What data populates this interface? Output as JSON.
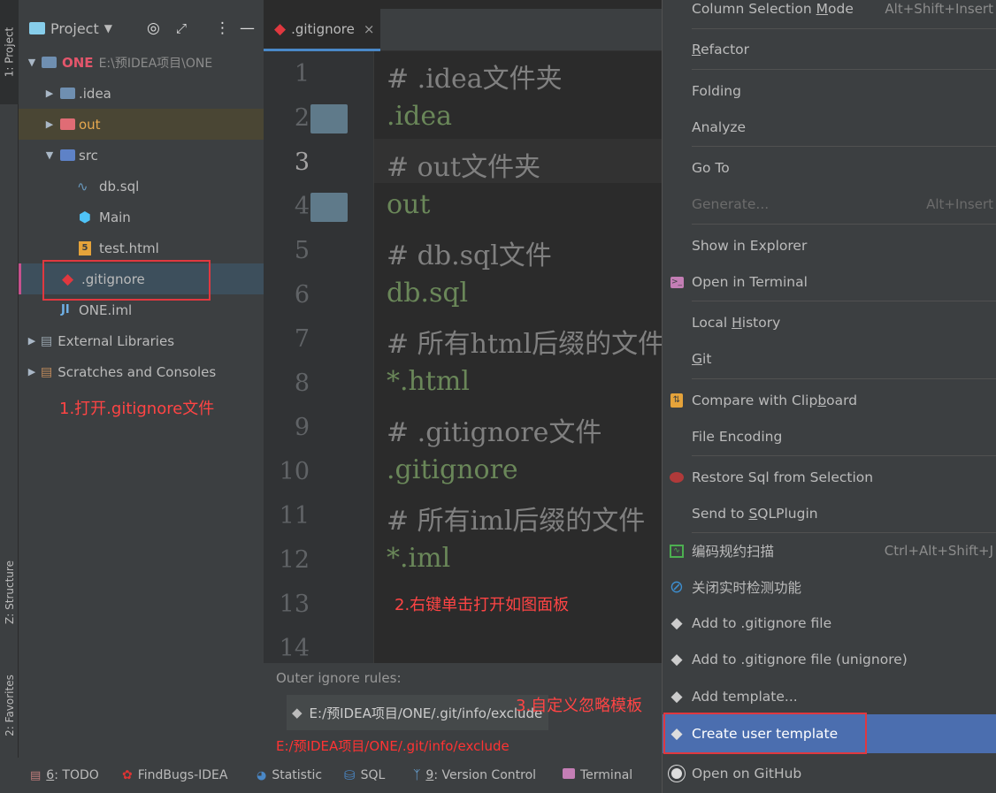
{
  "left_strip": {
    "project_tab": "1: Project",
    "structure_tab": "Z: Structure",
    "favorites_tab": "2: Favorites"
  },
  "project_panel": {
    "view_label": "Project",
    "root": {
      "name": "ONE",
      "path": "E:\\预IDEA项目\\ONE"
    },
    "items": [
      {
        "label": ".idea",
        "icon": "folder-idea-icon"
      },
      {
        "label": "out",
        "icon": "folder-out-icon"
      },
      {
        "label": "src",
        "icon": "folder-src-icon"
      },
      {
        "label": "db.sql",
        "icon": "sql-file-icon"
      },
      {
        "label": "Main",
        "icon": "java-class-icon"
      },
      {
        "label": "test.html",
        "icon": "html-file-icon"
      },
      {
        "label": ".gitignore",
        "icon": "gitignore-file-icon"
      },
      {
        "label": "ONE.iml",
        "icon": "iml-file-icon"
      },
      {
        "label": "External Libraries",
        "icon": "library-icon"
      },
      {
        "label": "Scratches and Consoles",
        "icon": "scratches-icon"
      }
    ],
    "annotation": "1.打开.gitignore文件"
  },
  "editor": {
    "tab_label": ".gitignore",
    "tab_close": "×",
    "lines": [
      {
        "n": "1",
        "text": "# .idea文件夹",
        "kind": "comment"
      },
      {
        "n": "2",
        "text": ".idea",
        "kind": "entry"
      },
      {
        "n": "3",
        "text": "# out文件夹",
        "kind": "comment"
      },
      {
        "n": "4",
        "text": "out",
        "kind": "entry"
      },
      {
        "n": "5",
        "text": "# db.sql文件",
        "kind": "comment"
      },
      {
        "n": "6",
        "text": "db.sql",
        "kind": "entry"
      },
      {
        "n": "7",
        "text": "# 所有html后缀的文件",
        "kind": "comment"
      },
      {
        "n": "8",
        "text": "*.html",
        "kind": "entry"
      },
      {
        "n": "9",
        "text": "# .gitignore文件",
        "kind": "comment"
      },
      {
        "n": "10",
        "text": ".gitignore",
        "kind": "entry"
      },
      {
        "n": "11",
        "text": "# 所有iml后缀的文件",
        "kind": "comment"
      },
      {
        "n": "12",
        "text": "*.iml",
        "kind": "entry"
      },
      {
        "n": "13",
        "text": "",
        "kind": "comment"
      },
      {
        "n": "14",
        "text": "",
        "kind": "comment"
      }
    ],
    "annotation_2": "2.右键单击打开如图面板",
    "outer_rules_label": "Outer ignore rules:",
    "outer_rules_item": "E:/预IDEA项目/ONE/.git/info/exclude",
    "outer_rules_link": "E:/预IDEA项目/ONE/.git/info/exclude",
    "annotation_3": "3.自定义忽略模板"
  },
  "context_menu": {
    "column_selection": {
      "pre": "Column Selection ",
      "u": "M",
      "post": "ode",
      "shortcut": "Alt+Shift+Insert"
    },
    "refactor": {
      "pre": "",
      "u": "R",
      "post": "efactor"
    },
    "folding": "Folding",
    "analyze": "Analyze",
    "goto": "Go To",
    "generate": {
      "label": "Generate...",
      "shortcut": "Alt+Insert"
    },
    "show_in_explorer": "Show in Explorer",
    "open_in_terminal": "Open in Terminal",
    "local_history": {
      "pre": "Local ",
      "u": "H",
      "post": "istory"
    },
    "git": {
      "pre": "",
      "u": "G",
      "post": "it"
    },
    "compare_clipboard": {
      "pre": "Compare with Clip",
      "u": "b",
      "post": "oard"
    },
    "file_encoding": "File Encoding",
    "restore_sql": "Restore Sql from Selection",
    "send_sql": {
      "pre": "Send to ",
      "u": "S",
      "post": "QLPlugin"
    },
    "code_scan": {
      "label": "编码规约扫描",
      "shortcut": "Ctrl+Alt+Shift+J"
    },
    "disable_realtime": "关闭实时检测功能",
    "add_gitignore": "Add to .gitignore file",
    "add_gitignore_unignore": "Add to .gitignore file (unignore)",
    "add_template": "Add template...",
    "create_user_template": "Create user template",
    "open_github": "Open on GitHub"
  },
  "status_bar": {
    "todo": {
      "u": "6",
      "post": ": TODO"
    },
    "findbugs": "FindBugs-IDEA",
    "statistic": "Statistic",
    "sql": "SQL",
    "vcs": {
      "u": "9",
      "post": ": Version Control"
    },
    "terminal": "Terminal"
  },
  "colors": {
    "accent": "#4a88c7",
    "annotation": "#ff4444",
    "highlight_box": "#e0383f",
    "selected_menu": "#4b6eaf"
  }
}
